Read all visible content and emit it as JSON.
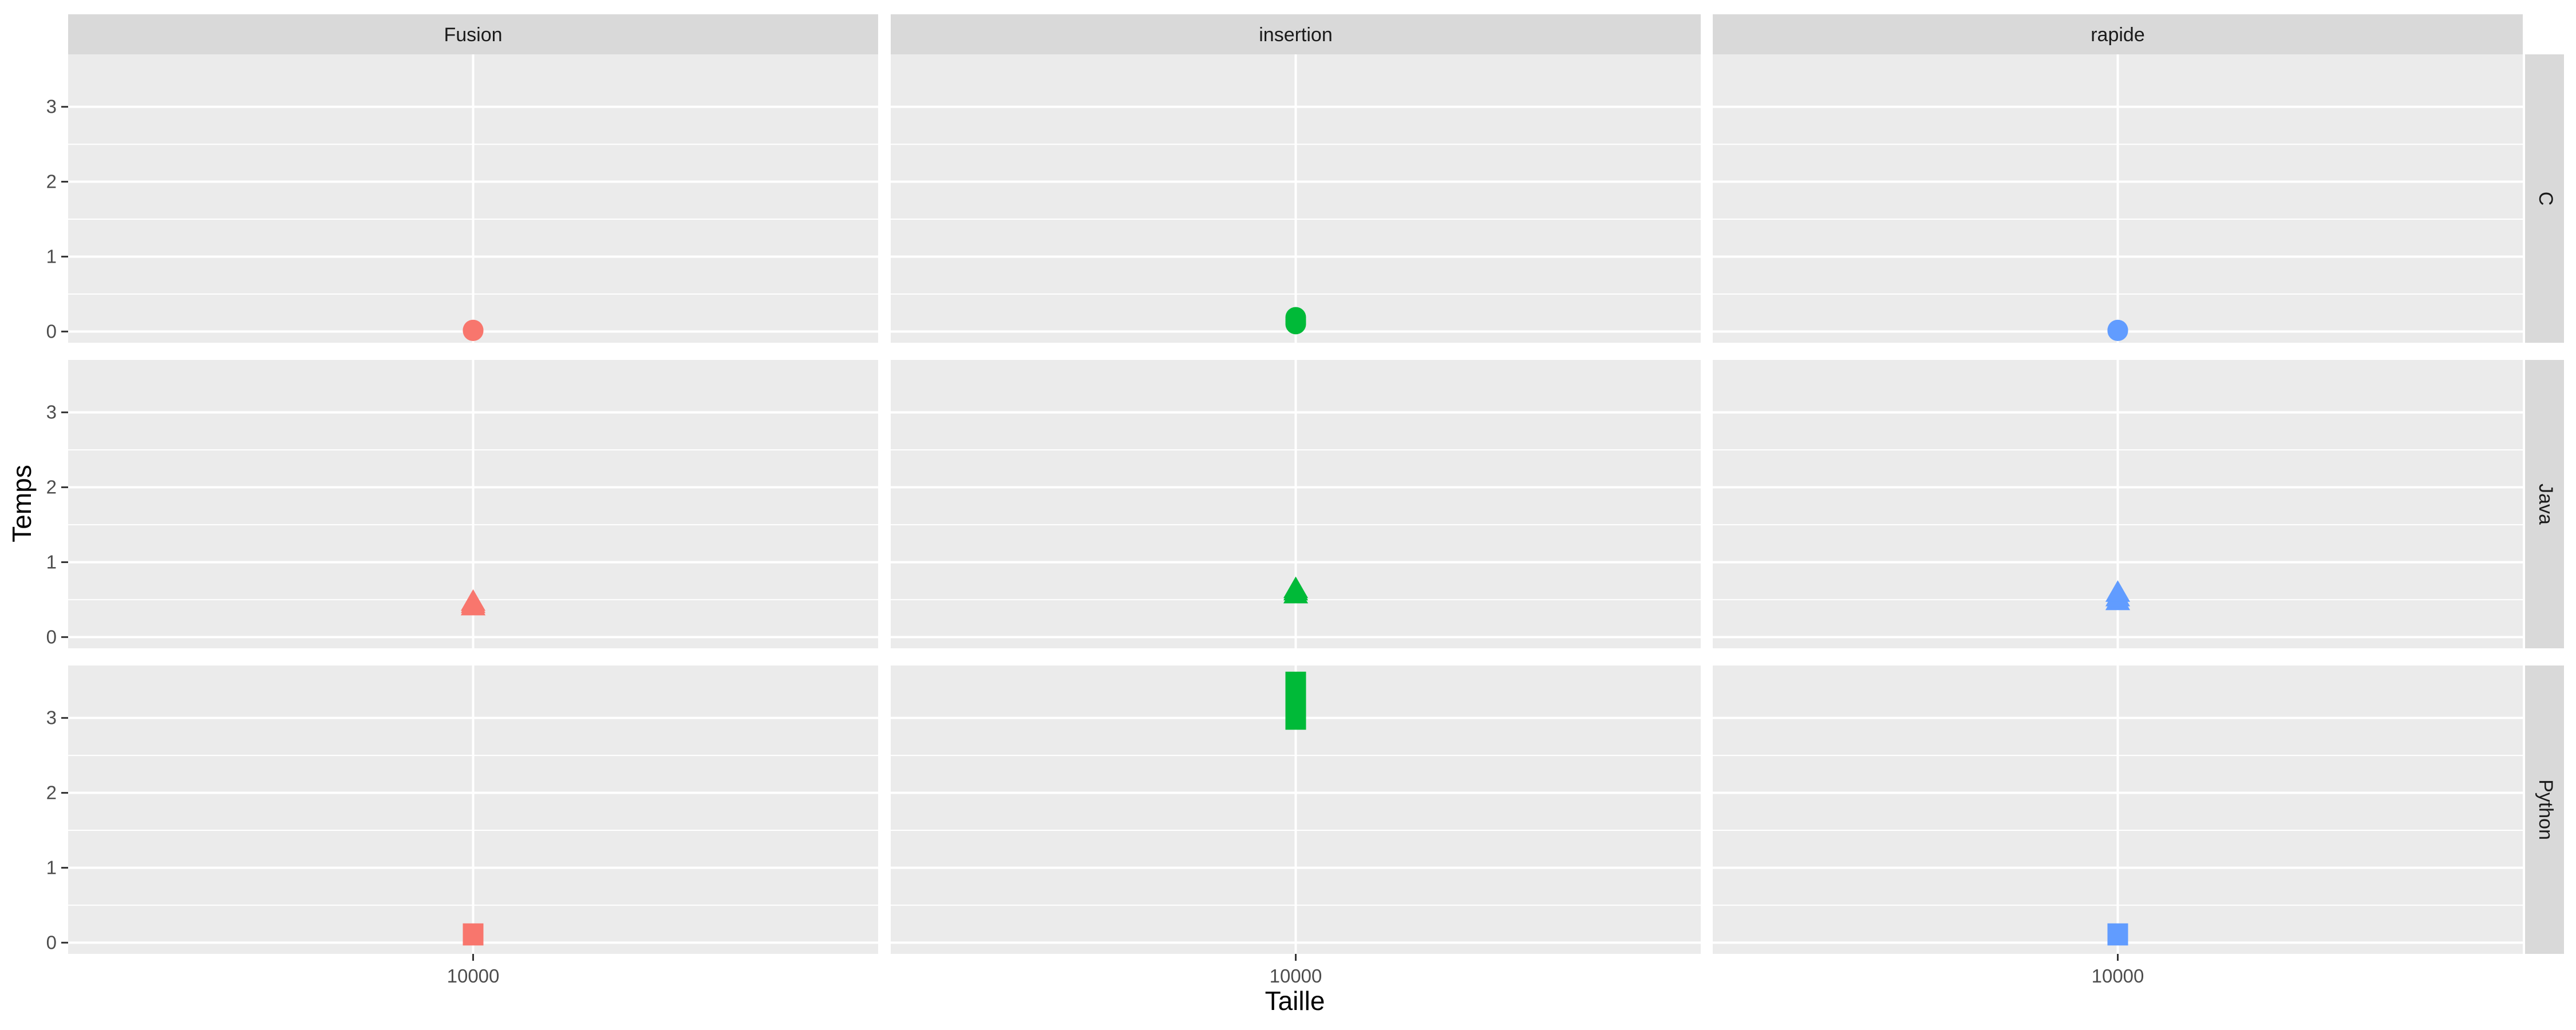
{
  "chart_data": {
    "type": "scatter",
    "title": "",
    "xlabel": "Taille",
    "ylabel": "Temps",
    "facet_cols": [
      "Fusion",
      "insertion",
      "rapide"
    ],
    "facet_rows": [
      "C",
      "Java",
      "Python"
    ],
    "x_ticks": [
      "10000"
    ],
    "y_ticks": [
      0,
      1,
      2,
      3
    ],
    "ylim": [
      -0.15,
      3.7
    ],
    "grid": true,
    "legend": "none",
    "colors": {
      "Fusion": "#F8766D",
      "insertion": "#00BA38",
      "rapide": "#619CFF"
    },
    "shapes": {
      "C": "circle",
      "Java": "triangle",
      "Python": "square"
    },
    "points": [
      {
        "col": "Fusion",
        "row": "C",
        "x": "10000",
        "y": [
          0.01,
          0.02
        ]
      },
      {
        "col": "insertion",
        "row": "C",
        "x": "10000",
        "y": [
          0.1,
          0.13,
          0.16,
          0.19
        ]
      },
      {
        "col": "rapide",
        "row": "C",
        "x": "10000",
        "y": [
          0.01,
          0.02
        ]
      },
      {
        "col": "Fusion",
        "row": "Java",
        "x": "10000",
        "y": [
          0.4,
          0.43,
          0.46
        ]
      },
      {
        "col": "insertion",
        "row": "Java",
        "x": "10000",
        "y": [
          0.56,
          0.6,
          0.63
        ]
      },
      {
        "col": "rapide",
        "row": "Java",
        "x": "10000",
        "y": [
          0.47,
          0.52,
          0.58
        ]
      },
      {
        "col": "Fusion",
        "row": "Python",
        "x": "10000",
        "y": [
          0.1,
          0.12
        ]
      },
      {
        "col": "insertion",
        "row": "Python",
        "x": "10000",
        "y": [
          2.98,
          3.08,
          3.18,
          3.28,
          3.38,
          3.48
        ]
      },
      {
        "col": "rapide",
        "row": "Python",
        "x": "10000",
        "y": [
          0.1,
          0.12
        ]
      }
    ]
  }
}
